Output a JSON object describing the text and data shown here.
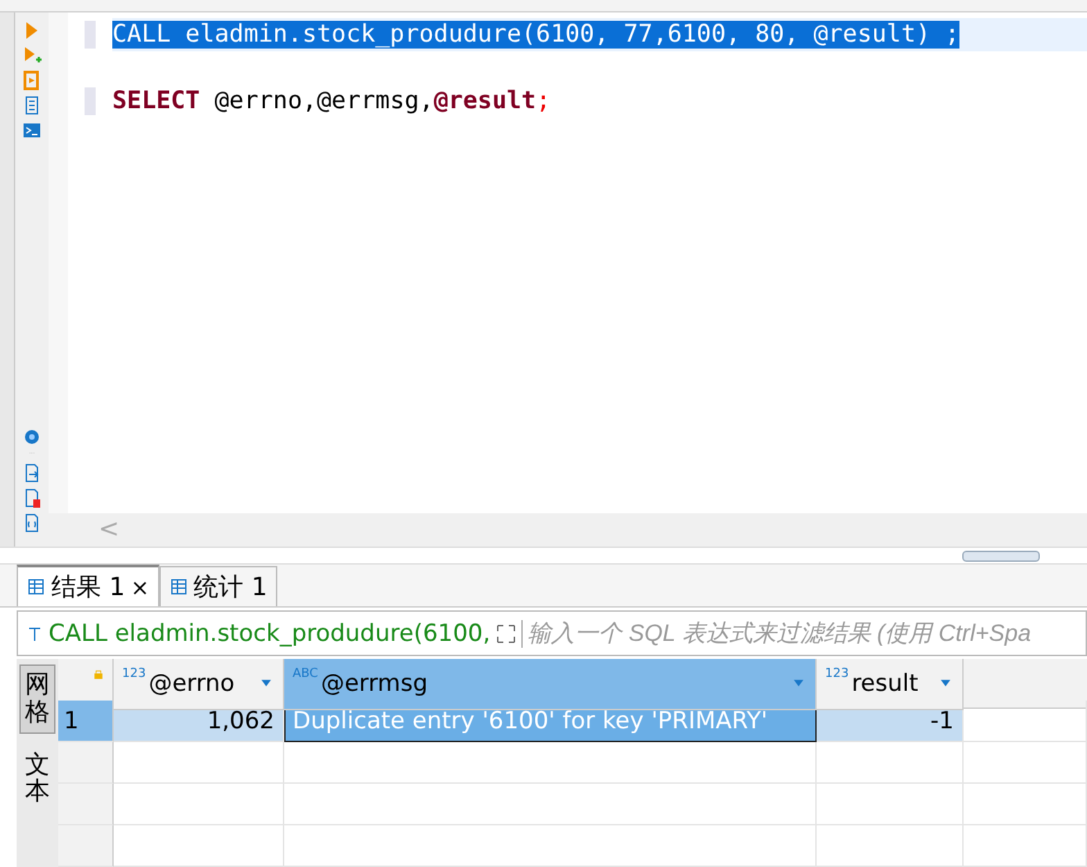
{
  "editor": {
    "lines": [
      {
        "kind": "call",
        "text": "CALL eladmin.stock_produdure(6100, 77,6100, 80, @result) ;",
        "selected": true
      },
      {
        "kind": "blank"
      },
      {
        "kind": "select",
        "keyword": "SELECT",
        "vars": "@errno,@errmsg,",
        "last": "@result",
        "end": ";"
      }
    ]
  },
  "scroll_left": "<",
  "result_tabs": [
    {
      "label": "结果 1",
      "close": "×",
      "selected": true
    },
    {
      "label": "统计 1",
      "selected": false
    }
  ],
  "filter": {
    "query": "CALL eladmin.stock_produdure(6100,",
    "placeholder": "输入一个 SQL 表达式来过滤结果 (使用 Ctrl+Spa"
  },
  "view_tabs": [
    {
      "label": "网格",
      "selected": true
    },
    {
      "label": "文本",
      "selected": false
    }
  ],
  "table": {
    "columns": [
      {
        "type": "123",
        "name": "@errno",
        "selected": false
      },
      {
        "type": "ABC",
        "name": "@errmsg",
        "selected": true
      },
      {
        "type": "123",
        "name": "result",
        "selected": false
      }
    ],
    "rows": [
      {
        "number": "1",
        "cells": [
          "1,062",
          "Duplicate entry '6100' for key 'PRIMARY'",
          "-1"
        ],
        "selected": true
      }
    ]
  }
}
